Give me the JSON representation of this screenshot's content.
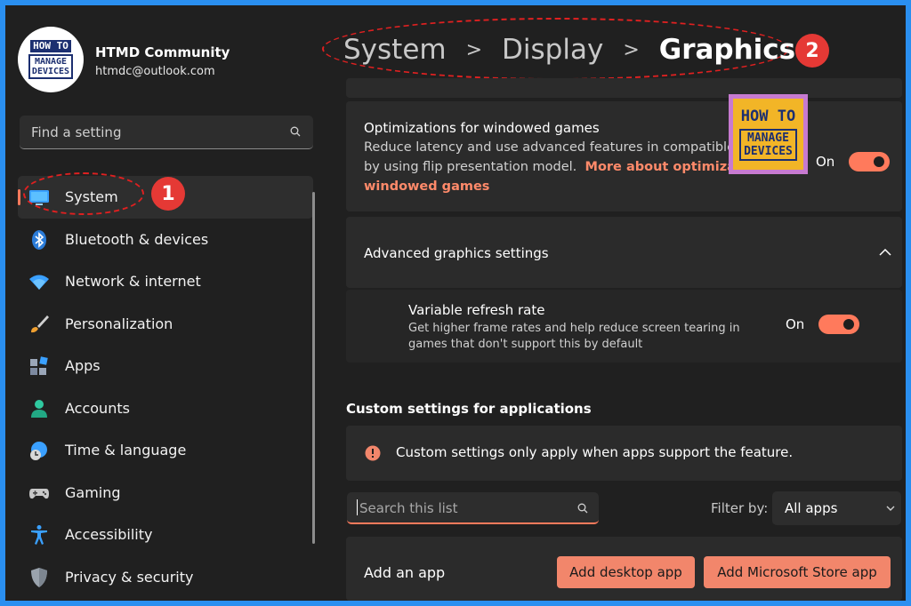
{
  "profile": {
    "name": "HTMD Community",
    "email": "htmdc@outlook.com",
    "logo_top": "HOW TO",
    "logo_line1": "MANAGE",
    "logo_line2": "DEVICES"
  },
  "search": {
    "placeholder": "Find a setting",
    "icon": "search-icon"
  },
  "sidebar": {
    "items": [
      {
        "label": "System",
        "icon": "monitor-icon",
        "active": true
      },
      {
        "label": "Bluetooth & devices",
        "icon": "bluetooth-icon"
      },
      {
        "label": "Network & internet",
        "icon": "wifi-icon"
      },
      {
        "label": "Personalization",
        "icon": "brush-icon"
      },
      {
        "label": "Apps",
        "icon": "apps-icon"
      },
      {
        "label": "Accounts",
        "icon": "person-icon"
      },
      {
        "label": "Time & language",
        "icon": "globe-clock-icon"
      },
      {
        "label": "Gaming",
        "icon": "gamepad-icon"
      },
      {
        "label": "Accessibility",
        "icon": "accessibility-icon"
      },
      {
        "label": "Privacy & security",
        "icon": "shield-icon"
      }
    ]
  },
  "annotations": {
    "badge1": "1",
    "badge2": "2"
  },
  "breadcrumb": [
    "System",
    "Display",
    "Graphics"
  ],
  "windowed_games": {
    "title": "Optimizations for windowed games",
    "desc_line1": "Reduce latency and use advanced features in compatible",
    "desc_line2_prefix": "by using flip presentation model.",
    "link_part1": "More about optimiza",
    "link_part2": "windowed games",
    "toggle_state": "On"
  },
  "advanced": {
    "title": "Advanced graphics settings"
  },
  "vrr": {
    "title": "Variable refresh rate",
    "desc_line1": "Get higher frame rates and help reduce screen tearing in",
    "desc_line2": "games that don't support this by default",
    "toggle_state": "On"
  },
  "custom": {
    "section_title": "Custom settings for applications",
    "info_text": "Custom settings only apply when apps support the feature.",
    "search_placeholder": "Search this list",
    "filter_label": "Filter by:",
    "filter_value": "All apps",
    "add_app_label": "Add an app",
    "add_desktop_button": "Add desktop app",
    "add_store_button": "Add Microsoft Store app"
  },
  "watermark": {
    "top": "HOW TO",
    "line1": "MANAGE",
    "line2": "DEVICES"
  },
  "colors": {
    "accent": "#ff7a5c",
    "annotation": "#e53935",
    "border": "#2a8ff0"
  }
}
